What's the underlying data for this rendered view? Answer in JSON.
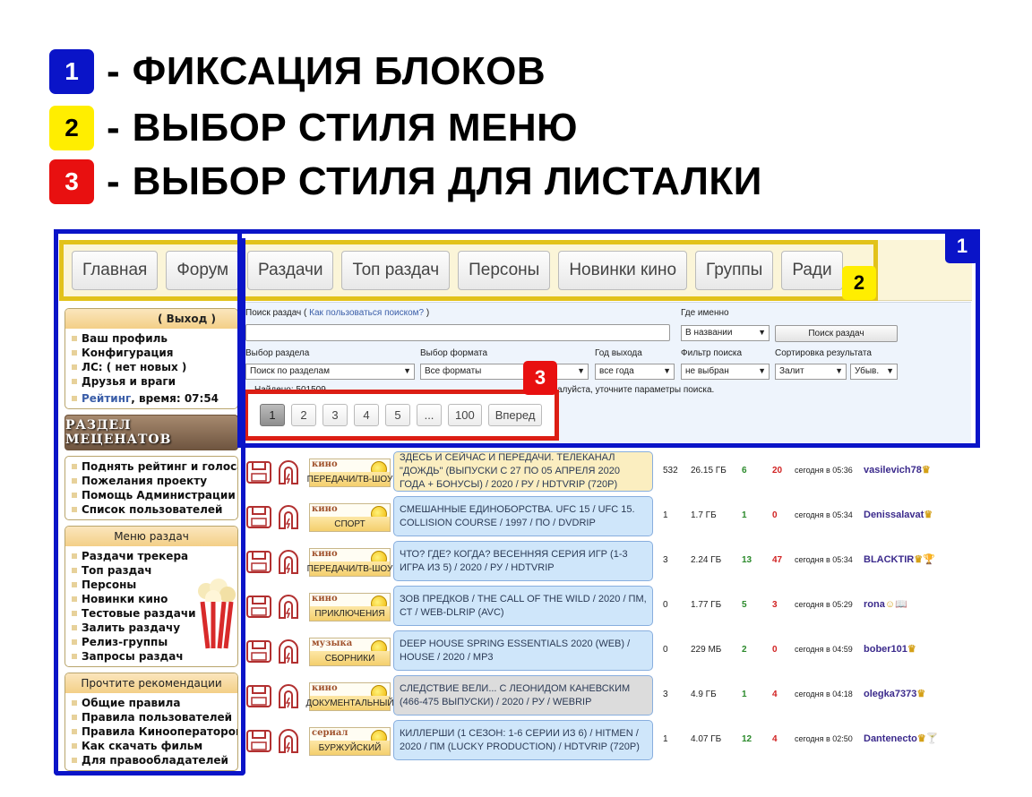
{
  "legend": [
    {
      "num": "1",
      "text": "ФИКСАЦИЯ БЛОКОВ",
      "bg": "#0a14c8",
      "fg": "#ffffff"
    },
    {
      "num": "2",
      "text": "ВЫБОР СТИЛЯ МЕНЮ",
      "bg": "#ffee00",
      "fg": "#000000"
    },
    {
      "num": "3",
      "text": "ВЫБОР СТИЛЯ ДЛЯ ЛИСТАЛКИ",
      "bg": "#e81010",
      "fg": "#ffffff"
    }
  ],
  "dash": "-",
  "markers": {
    "one": "1",
    "two": "2",
    "three": "3"
  },
  "nav": {
    "tabs": [
      "Главная",
      "Форум",
      "Раздачи",
      "Топ раздач",
      "Персоны",
      "Новинки кино",
      "Группы",
      "Ради"
    ]
  },
  "sidebar": {
    "user_header": "( Выход )",
    "user_items": [
      "Ваш профиль",
      "Конфигурация",
      "ЛС: ( нет новых )",
      "Друзья и враги"
    ],
    "rating_link": "Рейтинг",
    "rating_time": ", время: 07:54",
    "banner": "РАЗДЕЛ МЕЦЕНАТОВ",
    "support_items": [
      "Поднять рейтинг и голоса",
      "Пожелания проекту",
      "Помощь Администрации",
      "Список пользователей"
    ],
    "menu_header": "Меню раздач",
    "menu_items": [
      "Раздачи трекера",
      "Топ раздач",
      "Персоны",
      "Новинки кино",
      "Тестовые раздачи",
      "Залить раздачу",
      "Релиз-группы",
      "Запросы раздач"
    ],
    "rec_header": "Прочтите рекомендации",
    "rec_items": [
      "Общие правила",
      "Правила пользователей",
      "Правила Кинооператоров",
      "Как скачать фильм",
      "Для правообладателей"
    ]
  },
  "search": {
    "label": "Поиск раздач",
    "help_open": "(",
    "help_link": "Как пользоваться поиском?",
    "help_close": ")",
    "where_label": "Где именно",
    "where_value": "В названии",
    "search_button": "Поиск раздач",
    "section_label": "Выбор раздела",
    "section_value": "Поиск по разделам",
    "format_label": "Выбор формата",
    "format_value": "Все форматы",
    "year_label": "Год выхода",
    "year_value": "все года",
    "filter_label": "Фильтр поиска",
    "filter_value": "не выбран",
    "sort_label": "Сортировка результата",
    "sort_value": "Залит",
    "order_value": "Убыв.",
    "found_text": "Найдено: 501509",
    "note": "алуйста, уточните параметры поиска."
  },
  "pager": {
    "pages": [
      "1",
      "2",
      "3",
      "4",
      "5",
      "...",
      "100"
    ],
    "next": "Вперед",
    "active": "1"
  },
  "torrents": [
    {
      "cat_top": "кино",
      "cat": "ПЕРЕДАЧИ/ТВ-ШОУ",
      "title": "ЗДЕСЬ И СЕЙЧАС И ПЕРЕДАЧИ. ТЕЛЕКАНАЛ \"ДОЖДЬ\" (ВЫПУСКИ С 27 ПО 05 АПРЕЛЯ 2020 ГОДА + БОНУСЫ) / 2020 / РУ / HDTVRIP (720P)",
      "files": "532",
      "size": "26.15 ГБ",
      "seeds": "6",
      "leech": "20",
      "date": "сегодня в 05:36",
      "user": "vasilevich78",
      "badge": "♛",
      "bg": "#fbeec0"
    },
    {
      "cat_top": "кино",
      "cat": "СПОРТ",
      "title": "СМЕШАННЫЕ ЕДИНОБОРСТВА. UFC 15 / UFC 15. COLLISION COURSE / 1997 / ПО / DVDRIP",
      "files": "1",
      "size": "1.7 ГБ",
      "seeds": "1",
      "leech": "0",
      "date": "сегодня в 05:34",
      "user": "Denissalavat",
      "badge": "♛",
      "bg": "#cfe6fa"
    },
    {
      "cat_top": "кино",
      "cat": "ПЕРЕДАЧИ/ТВ-ШОУ",
      "title": "ЧТО? ГДЕ? КОГДА? ВЕСЕННЯЯ СЕРИЯ ИГР (1-3 ИГРА ИЗ 5) / 2020 / РУ / HDTVRIP",
      "files": "3",
      "size": "2.24 ГБ",
      "seeds": "13",
      "leech": "47",
      "date": "сегодня в 05:34",
      "user": "BLACKTIR",
      "badge": "♛🏆",
      "bg": "#cfe6fa"
    },
    {
      "cat_top": "кино",
      "cat": "ПРИКЛЮЧЕНИЯ",
      "title": "ЗОВ ПРЕДКОВ / THE CALL OF THE WILD / 2020 / ПМ, СТ / WEB-DLRIP (AVC)",
      "files": "0",
      "size": "1.77 ГБ",
      "seeds": "5",
      "leech": "3",
      "date": "сегодня в 05:29",
      "user": "rona",
      "badge": "☺📖",
      "bg": "#cfe6fa"
    },
    {
      "cat_top": "музыка",
      "cat": "СБОРНИКИ",
      "title": "DEEP HOUSE SPRING ESSENTIALS 2020 (WEB) / HOUSE / 2020 / MP3",
      "files": "0",
      "size": "229 МБ",
      "seeds": "2",
      "leech": "0",
      "date": "сегодня в 04:59",
      "user": "bober101",
      "badge": "♛",
      "bg": "#cfe6fa"
    },
    {
      "cat_top": "кино",
      "cat": "ДОКУМЕНТАЛЬНЫЙ",
      "title": "СЛЕДСТВИЕ ВЕЛИ... С ЛЕОНИДОМ КАНЕВСКИМ (466-475 ВЫПУСКИ) / 2020 / РУ / WEBRIP",
      "files": "3",
      "size": "4.9 ГБ",
      "seeds": "1",
      "leech": "4",
      "date": "сегодня в 04:18",
      "user": "olegka7373",
      "badge": "♛",
      "bg": "#dcdcdc"
    },
    {
      "cat_top": "сериал",
      "cat": "БУРЖУЙСКИЙ",
      "title": "КИЛЛЕРШИ (1 СЕЗОН: 1-6 СЕРИИ ИЗ 6) / HITMEN / 2020 / ПМ (LUCKY PRODUCTION) / HDTVRIP (720P)",
      "files": "1",
      "size": "4.07 ГБ",
      "seeds": "12",
      "leech": "4",
      "date": "сегодня в 02:50",
      "user": "Dantenecto",
      "badge": "♛🍸",
      "bg": "#cfe6fa"
    }
  ]
}
